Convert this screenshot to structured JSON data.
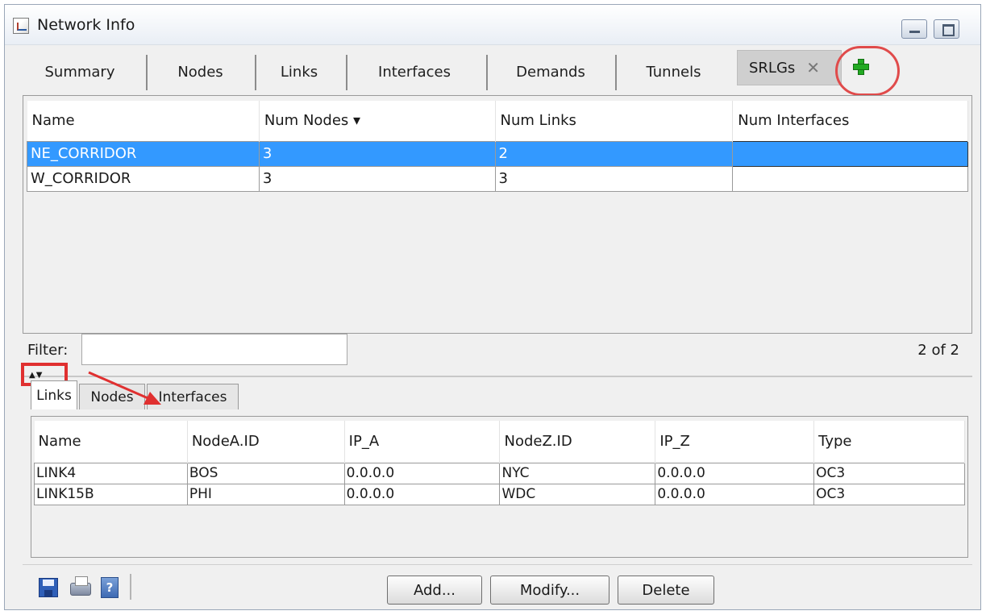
{
  "window": {
    "title": "Network Info"
  },
  "tabs": [
    {
      "label": "Summary"
    },
    {
      "label": "Nodes"
    },
    {
      "label": "Links"
    },
    {
      "label": "Interfaces"
    },
    {
      "label": "Demands"
    },
    {
      "label": "Tunnels"
    },
    {
      "label": "SRLGs"
    }
  ],
  "active_tab": "SRLGs",
  "srlg_table": {
    "columns": [
      "Name",
      "Num Nodes ▾",
      "Num Links",
      "Num Interfaces"
    ],
    "sort_column": "Num Nodes",
    "rows": [
      {
        "name": "NE_CORRIDOR",
        "num_nodes": "3",
        "num_links": "2",
        "num_interfaces": "",
        "selected": true
      },
      {
        "name": "W_CORRIDOR",
        "num_nodes": "3",
        "num_links": "3",
        "num_interfaces": "",
        "selected": false
      }
    ]
  },
  "filter": {
    "label": "Filter:",
    "value": "",
    "count": "2 of 2"
  },
  "splitter_arrows": "▲▼",
  "sub_tabs": [
    {
      "label": "Links"
    },
    {
      "label": "Nodes"
    },
    {
      "label": "Interfaces"
    }
  ],
  "active_sub_tab": "Links",
  "links_table": {
    "columns": [
      "Name",
      "NodeA.ID",
      "IP_A",
      "NodeZ.ID",
      "IP_Z",
      "Type"
    ],
    "rows": [
      [
        "LINK4",
        "BOS",
        "0.0.0.0",
        "NYC",
        "0.0.0.0",
        "OC3"
      ],
      [
        "LINK15B",
        "PHI",
        "0.0.0.0",
        "WDC",
        "0.0.0.0",
        "OC3"
      ]
    ]
  },
  "toolbar": {
    "add_label": "Add...",
    "modify_label": "Modify...",
    "delete_label": "Delete",
    "help_glyph": "?"
  },
  "colors": {
    "selection": "#3399ff",
    "annotation": "#e03030",
    "add_tab_plus": "#22aa22"
  }
}
